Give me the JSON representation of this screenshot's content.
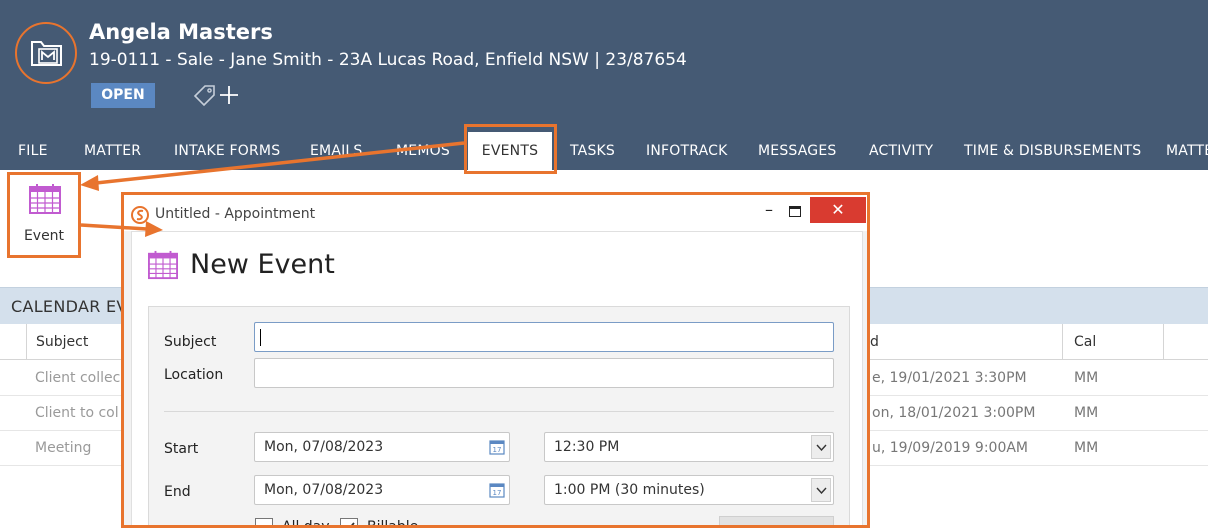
{
  "header": {
    "title": "Angela Masters",
    "subtitle": "19-0111 - Sale - Jane Smith - 23A Lucas Road, Enfield NSW | 23/87654",
    "status": "OPEN"
  },
  "tabs": [
    {
      "label": "FILE"
    },
    {
      "label": "MATTER"
    },
    {
      "label": "INTAKE FORMS"
    },
    {
      "label": "EMAILS"
    },
    {
      "label": "MEMOS"
    },
    {
      "label": "EVENTS"
    },
    {
      "label": "TASKS"
    },
    {
      "label": "INFOTRACK"
    },
    {
      "label": "MESSAGES"
    },
    {
      "label": "ACTIVITY"
    },
    {
      "label": "TIME & DISBURSEMENTS"
    },
    {
      "label": "MATTE"
    }
  ],
  "toolbar": {
    "event_label": "Event"
  },
  "calendar": {
    "section_title": "CALENDAR EV",
    "columns": {
      "subject": "Subject",
      "end": "d",
      "cal": "Cal"
    },
    "rows": [
      {
        "subject": "Client collec",
        "end": "e, 19/01/2021 3:30PM",
        "cal": "MM"
      },
      {
        "subject": "Client to col",
        "end": "on, 18/01/2021 3:00PM",
        "cal": "MM"
      },
      {
        "subject": "Meeting",
        "end": "u, 19/09/2019 9:00AM",
        "cal": "MM"
      }
    ]
  },
  "dialog": {
    "window_title": "Untitled - Appointment",
    "heading": "New Event",
    "labels": {
      "subject": "Subject",
      "location": "Location",
      "start": "Start",
      "end": "End",
      "all_day": "All day",
      "billable": "Billable"
    },
    "values": {
      "subject": "",
      "location": "",
      "start_date": "Mon, 07/08/2023",
      "start_time": "12:30 PM",
      "end_date": "Mon, 07/08/2023",
      "end_time": "1:00 PM (30 minutes)"
    },
    "controls": {
      "minimize": "–",
      "close": "✕"
    }
  },
  "colors": {
    "header_bg": "#455a74",
    "accent_orange": "#e8742e",
    "status_badge": "#5b88c2",
    "close_red": "#d93b30",
    "calendar_icon": "#c15bd0",
    "section_bar": "#d4e0ec"
  }
}
